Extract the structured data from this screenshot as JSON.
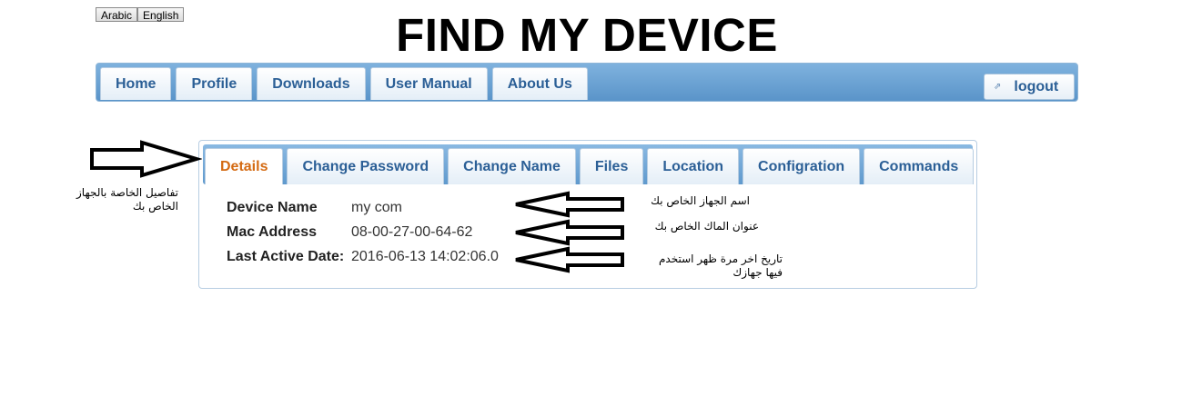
{
  "language_buttons": {
    "arabic": "Arabic",
    "english": "English"
  },
  "header": {
    "title": "FIND MY DEVICE"
  },
  "nav": {
    "items": [
      "Home",
      "Profile",
      "Downloads",
      "User Manual",
      "About Us"
    ],
    "logout_label": "logout",
    "logout_icon": "external-link-icon"
  },
  "panel": {
    "tabs": [
      "Details",
      "Change Password",
      "Change Name",
      "Files",
      "Location",
      "Configration",
      "Commands"
    ],
    "active_tab": "Details",
    "details": [
      {
        "label": "Device Name",
        "value": "my com"
      },
      {
        "label": "Mac Address",
        "value": "08-00-27-00-64-62"
      },
      {
        "label": "Last Active Date:",
        "value": "2016-06-13 14:02:06.0"
      }
    ]
  },
  "annotations": {
    "tab_note": "تفاصيل الخاصة بالجهاز الخاص بك",
    "device_name_note": "اسم الجهاز الخاص بك",
    "mac_note": "عنوان الماك الخاص بك",
    "last_active_note": "تاريخ اخر مرة ظهر استخدم فيها جهازك"
  },
  "colors": {
    "nav_gradient_top": "#7fb2de",
    "nav_gradient_bottom": "#5a94c9",
    "tab_text": "#2b5f96",
    "active_tab_text": "#d46a12"
  }
}
